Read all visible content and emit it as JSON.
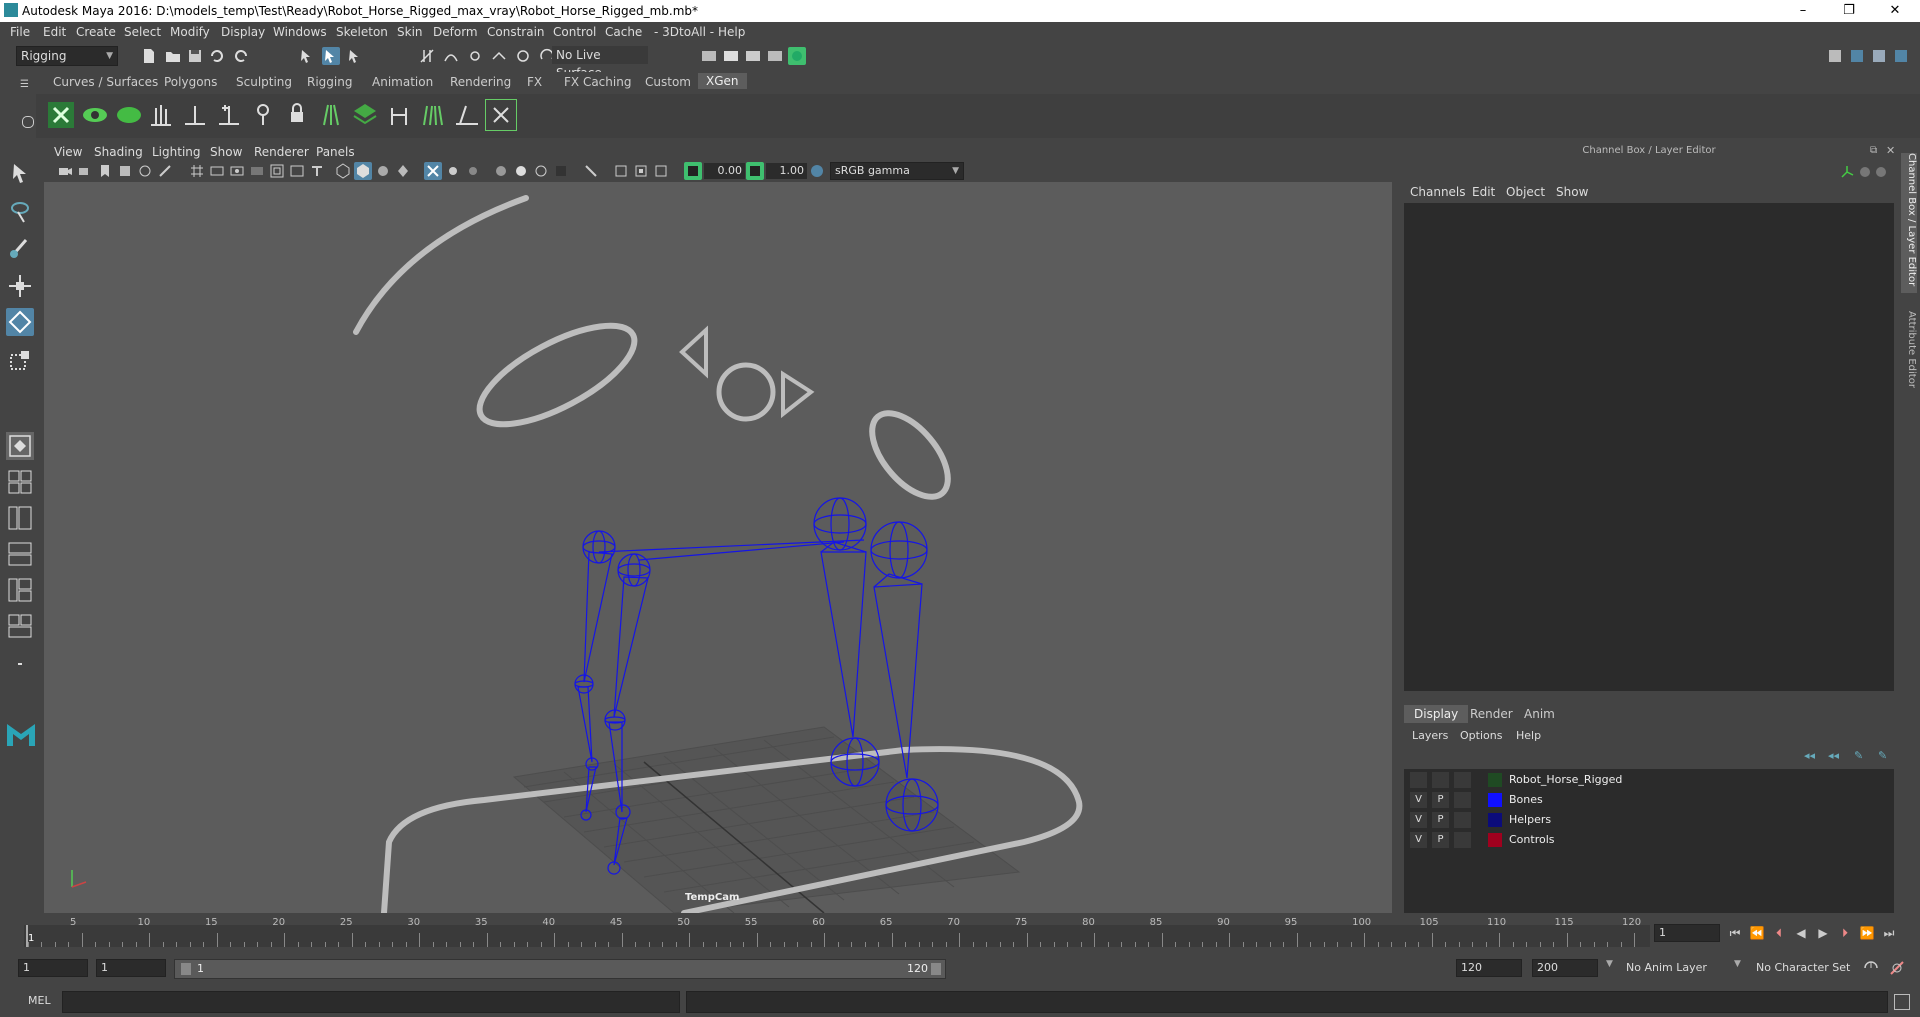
{
  "window": {
    "title": "Autodesk Maya 2016: D:\\models_temp\\Test\\Ready\\Robot_Horse_Rigged_max_vray\\Robot_Horse_Rigged_mb.mb*",
    "minimize": "–",
    "maximize": "❐",
    "close": "✕"
  },
  "menubar": [
    "File",
    "Edit",
    "Create",
    "Select",
    "Modify",
    "Display",
    "Windows",
    "Skeleton",
    "Skin",
    "Deform",
    "Constrain",
    "Control",
    "Cache",
    "- 3DtoAll -",
    "Help"
  ],
  "statusline": {
    "mode_dropdown": "Rigging",
    "live_surface": "No Live Surface"
  },
  "shelf_tabs": [
    "Curves / Surfaces",
    "Polygons",
    "Sculpting",
    "Rigging",
    "Animation",
    "Rendering",
    "FX",
    "FX Caching",
    "Custom",
    "XGen"
  ],
  "viewport": {
    "menu": [
      "View",
      "Shading",
      "Lighting",
      "Show",
      "Renderer",
      "Panels"
    ],
    "exposure": "0.00",
    "gamma": "1.00",
    "color_space": "sRGB gamma",
    "camera_label": "TempCam"
  },
  "channel_box": {
    "title": "Channel Box / Layer Editor",
    "menu": [
      "Channels",
      "Edit",
      "Object",
      "Show"
    ]
  },
  "layer_editor": {
    "tabs": [
      "Display",
      "Render",
      "Anim"
    ],
    "menu": [
      "Layers",
      "Options",
      "Help"
    ],
    "layers": [
      {
        "v": "",
        "p": "",
        "name": "Robot_Horse_Rigged",
        "color": "#1f4a23"
      },
      {
        "v": "V",
        "p": "P",
        "name": "Bones",
        "color": "#1010ff"
      },
      {
        "v": "V",
        "p": "P",
        "name": "Helpers",
        "color": "#0c0c7a"
      },
      {
        "v": "V",
        "p": "P",
        "name": "Controls",
        "color": "#a0001e"
      }
    ]
  },
  "side_tabs": [
    "Channel Box / Layer Editor",
    "Attribute Editor"
  ],
  "timeline": {
    "ticks": [
      "5",
      "10",
      "15",
      "20",
      "25",
      "30",
      "35",
      "40",
      "45",
      "50",
      "55",
      "60",
      "65",
      "70",
      "75",
      "80",
      "85",
      "90",
      "95",
      "100",
      "105",
      "110",
      "115",
      "120"
    ],
    "start_label": "1",
    "current_frame": "1"
  },
  "range": {
    "start": "1",
    "playback_start": "1",
    "slider_start": "1",
    "slider_end": "120",
    "playback_end": "120",
    "end": "200",
    "anim_layer": "No Anim Layer",
    "character_set": "No Character Set"
  },
  "cmdline": {
    "label": "MEL"
  },
  "colors": {
    "bones": "#1515e6",
    "curve": "#bdbdbd",
    "accent": "#5285a6"
  }
}
